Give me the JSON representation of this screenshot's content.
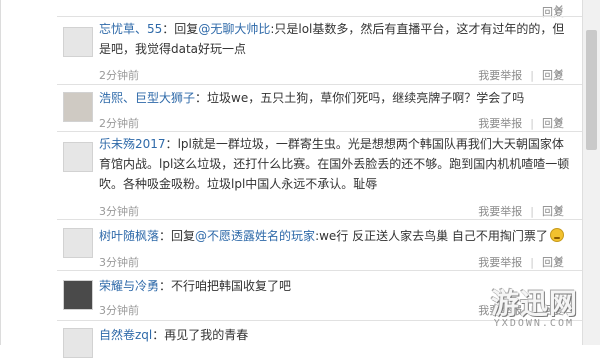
{
  "comments": [
    {
      "top_actions": {
        "reply": "回复",
        "close_glyph": "✕"
      }
    },
    {
      "user": "忘忧草、55",
      "separator": "：",
      "reply_prefix": "回复",
      "mention": "@无聊大帅比",
      "text_after_mention": ":只是lol基数多，然后有直播平台，这才有过年的的，但是吧，我觉得data好玩一点",
      "time": "2分钟前",
      "report": "我要举报",
      "reply": "回复",
      "close_glyph": "✕"
    },
    {
      "user": "浩熙、巨型大狮子",
      "separator": "：",
      "text": "垃圾we，五只土狗，草你们死吗，继续亮牌子啊？学会了吗",
      "time": "2分钟前",
      "report": "我要举报",
      "reply": "回复",
      "close_glyph": "✕"
    },
    {
      "user": "乐未殇2017",
      "separator": "：",
      "text": "lpl就是一群垃圾，一群寄生虫。光是想想两个韩国队再我们大天朝国家体育馆内战。lpl这么垃圾，还打什么比赛。在国外丢脸丢的还不够。跑到国内机机喳喳一顿吹。各种吸金吸粉。垃圾lpl中国人永远不承认。耻辱",
      "time": "3分钟前",
      "report": "我要举报",
      "reply": "回复",
      "close_glyph": "✕"
    },
    {
      "user": "树叶随枫落",
      "separator": "：",
      "reply_prefix": "回复",
      "mention": "@不愿透露姓名的玩家",
      "text_after_mention": ":we行 反正送人家去鸟巢 自己不用掏门票了",
      "time": "3分钟前",
      "report": "我要举报",
      "reply": "回复",
      "close_glyph": "✕"
    },
    {
      "user": "荣耀与冷勇",
      "separator": "：",
      "text": "不行咱把韩国收复了吧",
      "time": "3分钟前",
      "report": "我要举报",
      "reply": "回复"
    },
    {
      "user": "自然卷zql",
      "separator": "：",
      "text": "再见了我的青春"
    }
  ],
  "watermark": {
    "brand": "游迅网",
    "url": "YXDOWN.COM"
  },
  "icons": {
    "close": "close-icon",
    "emoji": "grin-emoji-icon",
    "avatar": "avatar"
  },
  "colors": {
    "link": "#2f6aa9",
    "meta": "#9a9a9a",
    "separator": "#e1e1e1"
  }
}
